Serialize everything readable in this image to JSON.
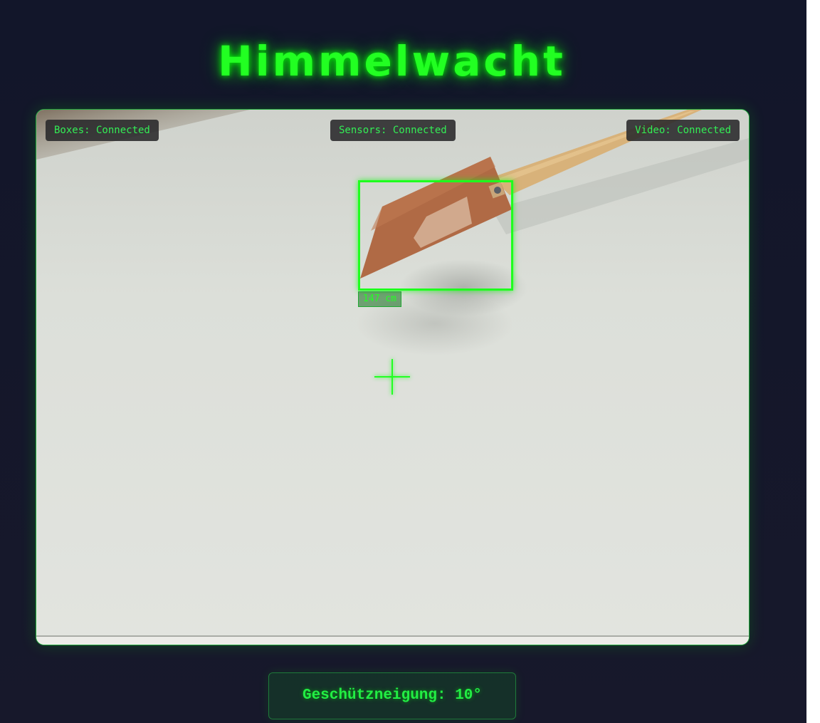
{
  "app": {
    "title": "Himmelwacht"
  },
  "status": {
    "boxes": "Boxes: Connected",
    "sensors": "Sensors: Connected",
    "video": "Video: Connected"
  },
  "detection": {
    "distance_label": "147 cm"
  },
  "footer": {
    "tilt_text": "Geschützneigung: 10°"
  },
  "colors": {
    "accent": "#22ff22",
    "background": "#13172a",
    "panel": "#14462a"
  }
}
